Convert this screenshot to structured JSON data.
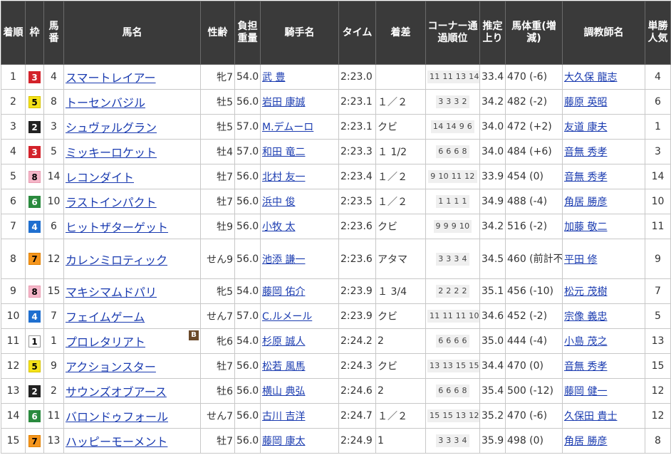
{
  "headers": {
    "rank": "着順",
    "waku": "枠",
    "num": "馬番",
    "horse": "馬名",
    "sexage": "性齢",
    "load": "負担重量",
    "jockey": "騎手名",
    "time": "タイム",
    "margin": "着差",
    "corner": "コーナー通過順位",
    "last3f": "推定上り",
    "weight": "馬体重(増減)",
    "trainer": "調教師名",
    "pop": "単勝人気"
  },
  "waku_colors": {
    "1": {
      "bg": "#ffffff",
      "fg": "#000000",
      "border": "#999999"
    },
    "2": {
      "bg": "#222222",
      "fg": "#ffffff",
      "border": "#222222"
    },
    "3": {
      "bg": "#d3222a",
      "fg": "#ffffff",
      "border": "#d3222a"
    },
    "4": {
      "bg": "#1f6fcf",
      "fg": "#ffffff",
      "border": "#1f6fcf"
    },
    "5": {
      "bg": "#f5e21a",
      "fg": "#000000",
      "border": "#d6c300"
    },
    "6": {
      "bg": "#2a8a3e",
      "fg": "#ffffff",
      "border": "#2a8a3e"
    },
    "7": {
      "bg": "#f5961e",
      "fg": "#000000",
      "border": "#e08000"
    },
    "8": {
      "bg": "#f5b6c8",
      "fg": "#000000",
      "border": "#e89ab0"
    }
  },
  "rows": [
    {
      "rank": "1",
      "waku": "3",
      "num": "4",
      "horse": "スマートレイアー",
      "sexage": "牝7",
      "load": "54.0",
      "jockey": "武 豊",
      "time": "2:23.0",
      "margin": "",
      "corner": "11 11 13 14",
      "last3f": "33.4",
      "weight": "470 (-6)",
      "trainer": "大久保 龍志",
      "pop": "4"
    },
    {
      "rank": "2",
      "waku": "5",
      "num": "8",
      "horse": "トーセンバジル",
      "sexage": "牡5",
      "load": "56.0",
      "jockey": "岩田 康誠",
      "time": "2:23.1",
      "margin": "１／２",
      "corner": "3 3 3 2",
      "last3f": "34.2",
      "weight": "482 (-2)",
      "trainer": "藤原 英昭",
      "pop": "6"
    },
    {
      "rank": "3",
      "waku": "2",
      "num": "3",
      "horse": "シュヴァルグラン",
      "sexage": "牡5",
      "load": "57.0",
      "jockey": "M.デムーロ",
      "time": "2:23.1",
      "margin": "クビ",
      "corner": "14 14 9 6",
      "last3f": "34.0",
      "weight": "472 (+2)",
      "trainer": "友道 康夫",
      "pop": "1"
    },
    {
      "rank": "4",
      "waku": "3",
      "num": "5",
      "horse": "ミッキーロケット",
      "sexage": "牡4",
      "load": "57.0",
      "jockey": "和田 竜二",
      "time": "2:23.3",
      "margin": "１ 1/2",
      "corner": "6 6 6 8",
      "last3f": "34.0",
      "weight": "484 (+6)",
      "trainer": "音無 秀孝",
      "pop": "3"
    },
    {
      "rank": "5",
      "waku": "8",
      "num": "14",
      "horse": "レコンダイト",
      "sexage": "牡7",
      "load": "56.0",
      "jockey": "北村 友一",
      "time": "2:23.4",
      "margin": "１／２",
      "corner": "9 10 11 12",
      "last3f": "33.9",
      "weight": "454 (0)",
      "trainer": "音無 秀孝",
      "pop": "14"
    },
    {
      "rank": "6",
      "waku": "6",
      "num": "10",
      "horse": "ラストインパクト",
      "sexage": "牡7",
      "load": "56.0",
      "jockey": "浜中 俊",
      "time": "2:23.5",
      "margin": "１／２",
      "corner": "1 1 1 1",
      "last3f": "34.9",
      "weight": "488 (-4)",
      "trainer": "角居 勝彦",
      "pop": "10"
    },
    {
      "rank": "7",
      "waku": "4",
      "num": "6",
      "horse": "ヒットザターゲット",
      "sexage": "牡9",
      "load": "56.0",
      "jockey": "小牧 太",
      "time": "2:23.6",
      "margin": "クビ",
      "corner": "9 9 9 10",
      "last3f": "34.2",
      "weight": "516 (-2)",
      "trainer": "加藤 敬二",
      "pop": "11"
    },
    {
      "rank": "8",
      "waku": "7",
      "num": "12",
      "horse": "カレンミロティック",
      "sexage": "せん9",
      "load": "56.0",
      "jockey": "池添 謙一",
      "time": "2:23.6",
      "margin": "アタマ",
      "corner": "3 3 3 4",
      "last3f": "34.5",
      "weight": "460 (前計不)",
      "trainer": "平田 修",
      "pop": "9",
      "tall": true
    },
    {
      "rank": "9",
      "waku": "8",
      "num": "15",
      "horse": "マキシマムドパリ",
      "sexage": "牝5",
      "load": "54.0",
      "jockey": "藤岡 佑介",
      "time": "2:23.9",
      "margin": "１ 3/4",
      "corner": "2 2 2 2",
      "last3f": "35.1",
      "weight": "456 (-10)",
      "trainer": "松元 茂樹",
      "pop": "7"
    },
    {
      "rank": "10",
      "waku": "4",
      "num": "7",
      "horse": "フェイムゲーム",
      "sexage": "せん7",
      "load": "57.0",
      "jockey": "C.ルメール",
      "time": "2:23.9",
      "margin": "クビ",
      "corner": "11 11 11 10",
      "last3f": "34.6",
      "weight": "452 (-2)",
      "trainer": "宗像 義忠",
      "pop": "5"
    },
    {
      "rank": "11",
      "waku": "1",
      "num": "1",
      "horse": "プロレタリアト",
      "sexage": "牝6",
      "load": "54.0",
      "jockey": "杉原 誠人",
      "time": "2:24.2",
      "margin": "2",
      "corner": "6 6 6 6",
      "last3f": "35.0",
      "weight": "444 (-4)",
      "trainer": "小島 茂之",
      "pop": "13",
      "badge": "B"
    },
    {
      "rank": "12",
      "waku": "5",
      "num": "9",
      "horse": "アクションスター",
      "sexage": "牡7",
      "load": "56.0",
      "jockey": "松若 風馬",
      "time": "2:24.3",
      "margin": "クビ",
      "corner": "13 13 15 15",
      "last3f": "34.4",
      "weight": "470 (0)",
      "trainer": "音無 秀孝",
      "pop": "15"
    },
    {
      "rank": "13",
      "waku": "2",
      "num": "2",
      "horse": "サウンズオブアース",
      "sexage": "牡6",
      "load": "56.0",
      "jockey": "横山 典弘",
      "time": "2:24.6",
      "margin": "2",
      "corner": "6 6 6 8",
      "last3f": "35.4",
      "weight": "500 (-12)",
      "trainer": "藤岡 健一",
      "pop": "12"
    },
    {
      "rank": "14",
      "waku": "6",
      "num": "11",
      "horse": "バロンドゥフォール",
      "sexage": "せん7",
      "load": "56.0",
      "jockey": "古川 吉洋",
      "time": "2:24.7",
      "margin": "１／２",
      "corner": "15 15 13 12",
      "last3f": "35.2",
      "weight": "470 (-6)",
      "trainer": "久保田 貴士",
      "pop": "12"
    },
    {
      "rank": "15",
      "waku": "7",
      "num": "13",
      "horse": "ハッピーモーメント",
      "sexage": "牡7",
      "load": "56.0",
      "jockey": "藤岡 康太",
      "time": "2:24.9",
      "margin": "1",
      "corner": "3 3 3 4",
      "last3f": "35.9",
      "weight": "498 (0)",
      "trainer": "角居 勝彦",
      "pop": "8"
    }
  ]
}
